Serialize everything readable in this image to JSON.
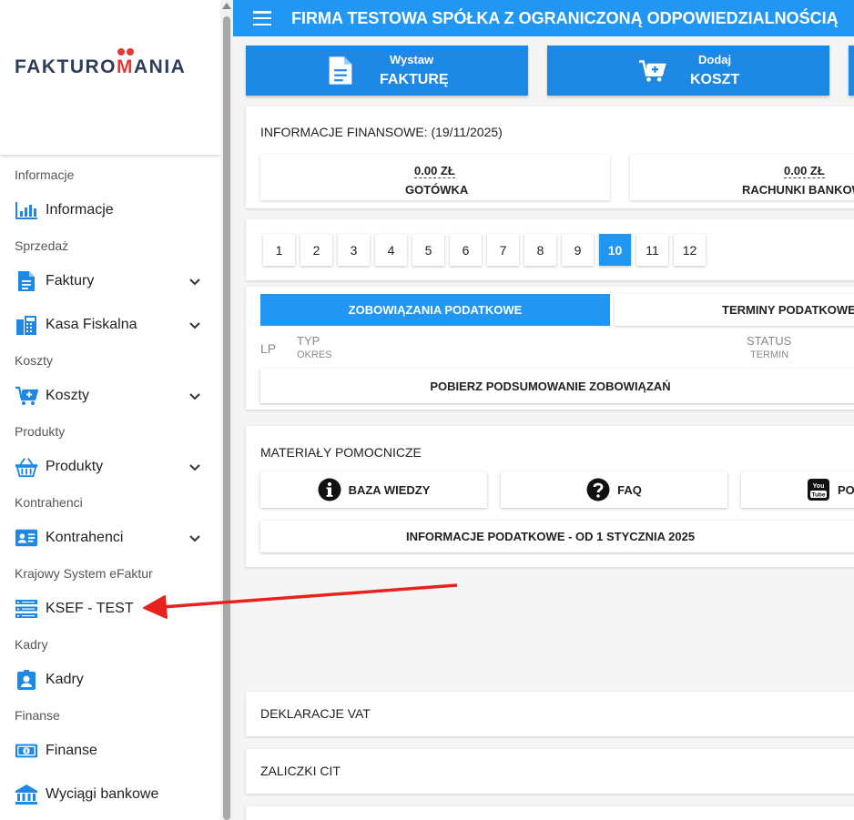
{
  "header": {
    "company": "FIRMA TESTOWA SPÓŁKA Z OGRANICZONĄ ODPOWIEDZIALNOŚCIĄ"
  },
  "logo": {
    "text_left": "FAKTURO",
    "text_m": "M",
    "text_right": "ANIA"
  },
  "sidebar": {
    "sections": [
      {
        "title": "Informacje",
        "item": "Informacje",
        "icon": "bar-chart-icon",
        "chevron": false
      },
      {
        "title": "Sprzedaż",
        "item": "Faktury",
        "icon": "document-icon",
        "chevron": true
      },
      {
        "title": "",
        "item": "Kasa Fiskalna",
        "icon": "cash-register-icon",
        "chevron": true
      },
      {
        "title": "Koszty",
        "item": "Koszty",
        "icon": "cart-plus-icon",
        "chevron": true
      },
      {
        "title": "Produkty",
        "item": "Produkty",
        "icon": "basket-icon",
        "chevron": true
      },
      {
        "title": "Kontrahenci",
        "item": "Kontrahenci",
        "icon": "contact-card-icon",
        "chevron": true
      },
      {
        "title": "Krajowy System eFaktur",
        "item": "KSEF - TEST",
        "icon": "server-icon",
        "chevron": false
      },
      {
        "title": "Kadry",
        "item": "Kadry",
        "icon": "person-badge-icon",
        "chevron": false
      },
      {
        "title": "Finanse",
        "item": "Finanse",
        "icon": "banknote-icon",
        "chevron": false
      },
      {
        "title": "",
        "item": "Wyciągi bankowe",
        "icon": "bank-icon",
        "chevron": false
      }
    ]
  },
  "actions": {
    "invoice": {
      "line1": "Wystaw",
      "line2": "FAKTURĘ",
      "icon": "document-icon"
    },
    "cost": {
      "line1": "Dodaj",
      "line2": "KOSZT",
      "icon": "cart-plus-icon"
    }
  },
  "finance": {
    "title": "INFORMACJE FINANSOWE: (19/11/2025)",
    "cash": {
      "amount": "0.00 ZŁ",
      "label": "GOTÓWKA"
    },
    "bank": {
      "amount": "0.00 ZŁ",
      "label": "RACHUNKI BANKOW"
    }
  },
  "months": {
    "items": [
      "1",
      "2",
      "3",
      "4",
      "5",
      "6",
      "7",
      "8",
      "9",
      "10",
      "11",
      "12"
    ],
    "active": "10"
  },
  "tax": {
    "tab_active": "ZOBOWIĄZANIA PODATKOWE",
    "tab_other": "TERMINY PODATKOWE",
    "col_lp": "LP",
    "col_type": "TYP",
    "col_period": "OKRES",
    "col_status": "STATUS",
    "col_deadline": "TERMIN",
    "fetch_button": "POBIERZ PODSUMOWANIE ZOBOWIĄZAŃ"
  },
  "materials": {
    "title": "MATERIAŁY POMOCNICZE",
    "kb": "BAZA WIEDZY",
    "faq": "FAQ",
    "yt": "PO",
    "tax_info": "INFORMACJE PODATKOWE - OD 1 STYCZNIA 2025"
  },
  "accordions": {
    "vat": "DEKLARACJE VAT",
    "cit": "ZALICZKI CIT"
  },
  "colors": {
    "primary": "#2196f3",
    "button": "#1e88e5",
    "arrow": "#e8221f",
    "logo_text": "#2c3e5c",
    "logo_accent": "#e53935"
  }
}
